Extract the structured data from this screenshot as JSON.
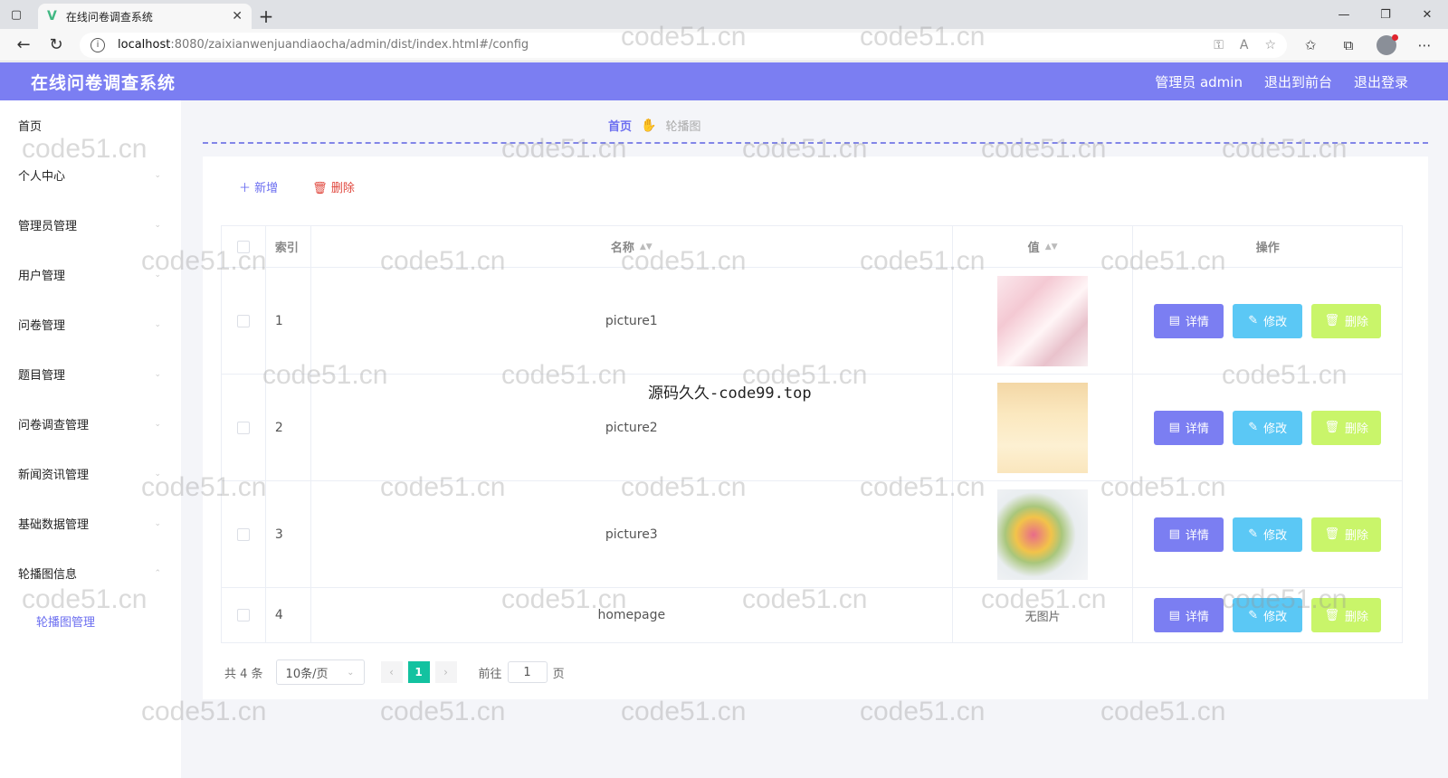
{
  "browser": {
    "tab_title": "在线问卷调查系统",
    "url_host": "localhost",
    "url_path": ":8080/zaixianwenjuandiaocha/admin/dist/index.html#/config"
  },
  "header": {
    "title": "在线问卷调查系统",
    "user_label": "管理员 admin",
    "back_front": "退出到前台",
    "logout": "退出登录",
    "color": "#7b7ef2"
  },
  "sidebar": {
    "items": [
      {
        "label": "首页"
      },
      {
        "label": "个人中心"
      },
      {
        "label": "管理员管理"
      },
      {
        "label": "用户管理"
      },
      {
        "label": "问卷管理"
      },
      {
        "label": "题目管理"
      },
      {
        "label": "问卷调查管理"
      },
      {
        "label": "新闻资讯管理"
      },
      {
        "label": "基础数据管理"
      },
      {
        "label": "轮播图信息"
      }
    ],
    "sub_item": "轮播图管理"
  },
  "breadcrumb": {
    "home": "首页",
    "current": "轮播图"
  },
  "actions": {
    "add": "新增",
    "delete": "删除"
  },
  "table": {
    "headers": {
      "index": "索引",
      "name": "名称",
      "value": "值",
      "ops": "操作"
    },
    "rows": [
      {
        "index": "1",
        "name": "picture1",
        "value": ""
      },
      {
        "index": "2",
        "name": "picture2",
        "value": ""
      },
      {
        "index": "3",
        "name": "picture3",
        "value": ""
      },
      {
        "index": "4",
        "name": "homepage",
        "value": "无图片"
      }
    ],
    "btn_detail": "详情",
    "btn_edit": "修改",
    "btn_delete": "删除"
  },
  "pager": {
    "total": "共 4 条",
    "page_size": "10条/页",
    "current_page": "1",
    "goto_prefix": "前往",
    "goto_value": "1",
    "goto_suffix": "页"
  },
  "overlay": "源码久久-code99.top",
  "watermark": "code51.cn"
}
